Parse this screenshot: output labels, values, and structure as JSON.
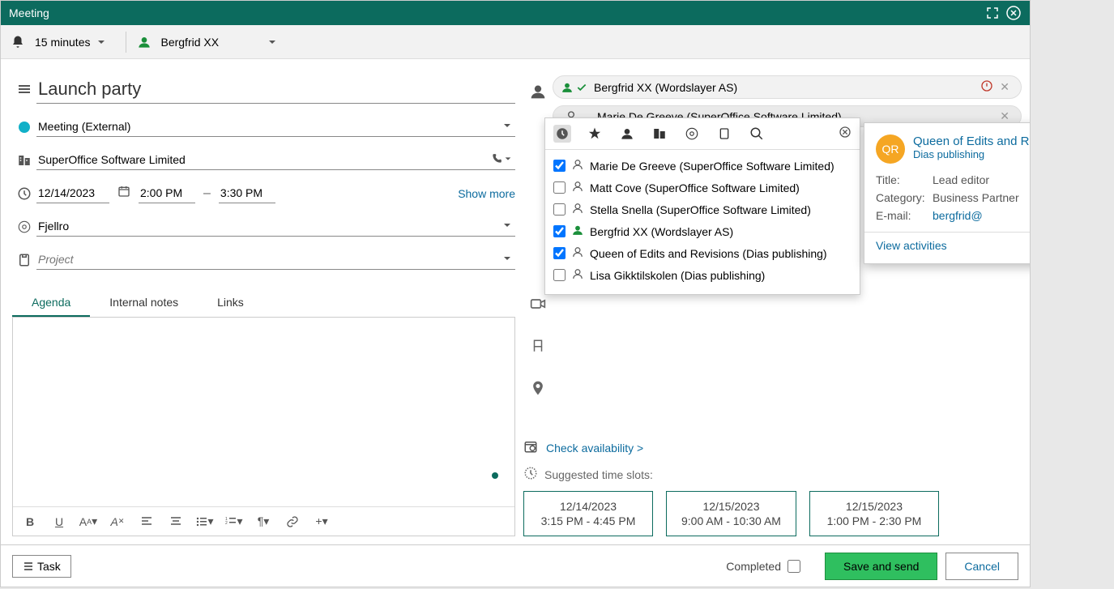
{
  "window": {
    "title": "Meeting"
  },
  "toolbar": {
    "reminder": "15 minutes",
    "owner": "Bergfrid XX"
  },
  "form": {
    "title": "Launch party",
    "type": "Meeting (External)",
    "company": "SuperOffice Software Limited",
    "date": "12/14/2023",
    "time_start": "2:00 PM",
    "time_end": "3:30 PM",
    "show_more": "Show more",
    "sale": "Fjellro",
    "project_placeholder": "Project"
  },
  "tabs": {
    "agenda": "Agenda",
    "notes": "Internal notes",
    "links": "Links"
  },
  "attendees": {
    "chip1": "Bergfrid XX (Wordslayer AS)",
    "chip2": "Marie De Greeve (SuperOffice Software Limited)"
  },
  "picker": {
    "items": [
      {
        "checked": true,
        "label": "Marie De Greeve (SuperOffice Software Limited)"
      },
      {
        "checked": false,
        "label": "Matt Cove (SuperOffice Software Limited)"
      },
      {
        "checked": false,
        "label": "Stella Snella (SuperOffice Software Limited)"
      },
      {
        "checked": true,
        "label": "Bergfrid XX (Wordslayer AS)",
        "green": true
      },
      {
        "checked": true,
        "label": "Queen of Edits and Revisions (Dias publishing)"
      },
      {
        "checked": false,
        "label": "Lisa Gikktilskolen (Dias publishing)"
      }
    ]
  },
  "info": {
    "initials": "QR",
    "name": "Queen of Edits and Revisions",
    "company": "Dias publishing",
    "title_label": "Title:",
    "title_value": "Lead editor",
    "category_label": "Category:",
    "category_value": "Business Partner",
    "email_label": "E-mail:",
    "email_value": "bergfrid@",
    "view_activities": "View activities"
  },
  "availability": {
    "check": "Check availability >",
    "slots_label": "Suggested time slots:",
    "slots": [
      {
        "date": "12/14/2023",
        "time": "3:15 PM - 4:45 PM"
      },
      {
        "date": "12/15/2023",
        "time": "9:00 AM - 10:30 AM"
      },
      {
        "date": "12/15/2023",
        "time": "1:00 PM - 2:30 PM"
      }
    ]
  },
  "footer": {
    "task": "Task",
    "completed": "Completed",
    "save": "Save and send",
    "cancel": "Cancel"
  }
}
